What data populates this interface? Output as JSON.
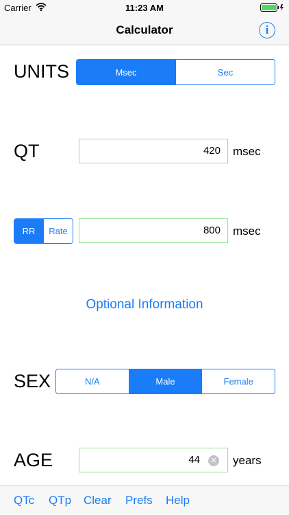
{
  "status": {
    "carrier": "Carrier",
    "time": "11:23 AM"
  },
  "nav": {
    "title": "Calculator",
    "info_glyph": "i"
  },
  "units": {
    "label": "UNITS",
    "options": [
      "Msec",
      "Sec"
    ],
    "selected": "Msec"
  },
  "qt": {
    "label": "QT",
    "value": "420",
    "unit": "msec"
  },
  "rr": {
    "options": [
      "RR",
      "Rate"
    ],
    "selected": "RR",
    "value": "800",
    "unit": "msec"
  },
  "optional_link": "Optional Information",
  "sex": {
    "label": "SEX",
    "options": [
      "N/A",
      "Male",
      "Female"
    ],
    "selected": "Male"
  },
  "age": {
    "label": "AGE",
    "value": "44",
    "unit": "years",
    "clear_glyph": "✕"
  },
  "tabs": [
    "QTc",
    "QTp",
    "Clear",
    "Prefs",
    "Help"
  ],
  "colors": {
    "accent": "#1a7cf6",
    "field_border": "#8ee58e"
  }
}
